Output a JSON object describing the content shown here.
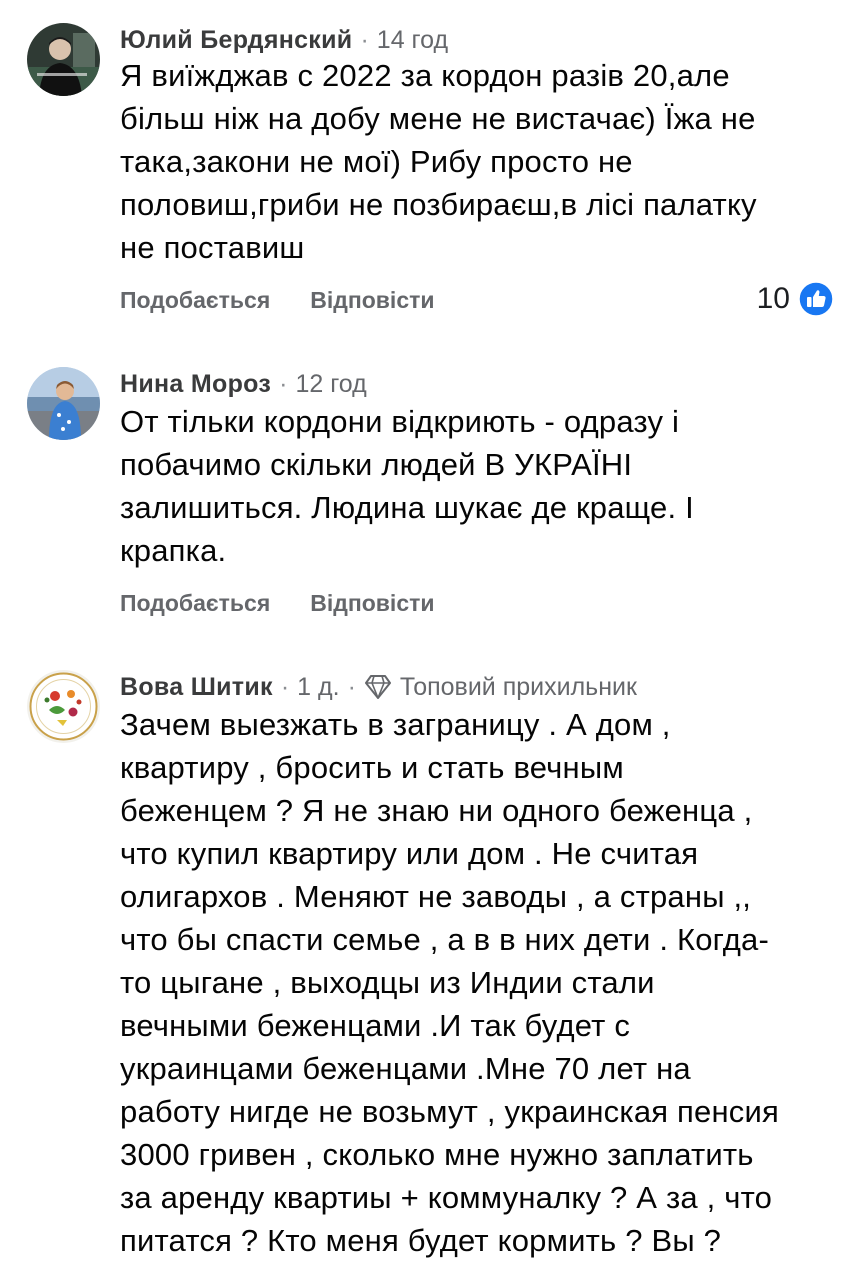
{
  "comments": [
    {
      "author": "Юлий Бердянский",
      "separator": "·",
      "time": "14 год",
      "text": "Я виїжджав с 2022 за кордон разів 20,але\nбільш ніж на добу мене не вистачає) Їжа не\nтака,закони не мої) Рибу просто не\nполовиш,гриби не позбираєш,в лісі палатку\nне поставиш",
      "like_label": "Подобається",
      "reply_label": "Відповісти",
      "reaction_count": "10",
      "reaction_icon": "like-thumb-icon"
    },
    {
      "author": "Нина Мороз",
      "separator": "·",
      "time": "12 год",
      "text": "От тільки кордони відкриють - одразу і\nпобачимо скільки людей В УКРАЇНІ\nзалишиться.  Людина шукає де краще. І\nкрапка.",
      "like_label": "Подобається",
      "reply_label": "Відповісти"
    },
    {
      "author": "Вова Шитик",
      "separator": "·",
      "time": "1 д.",
      "separator2": "·",
      "badge_icon": "diamond-icon",
      "badge": "Топовий прихильник",
      "text": "Зачем выезжать  в заграницу . А дом ,\nквартиру  , бросить и стать вечным\nбеженцем ? Я не знаю ни одного беженца ,\nчто купил квартиру или дом . Не считая\nолигархов . Меняют  не заводы , а страны ,,\nчто бы спасти семье , а в в них дети . Когда-\nто  цыгане  , выходцы из Индии стали\nвечными беженцами .И так будет с\nукраинцами  беженцами .Мне 70 лет на\nработу нигде не возьмут , украинская пенсия\n3000 гривен , сколько мне нужно заплатить\nза аренду квартиы + коммуналку ? А за , что\nпитатся ? Кто меня будет кормить ? Вы ?"
    }
  ],
  "colors": {
    "text": "#050505",
    "meta": "#65676b",
    "like_blue": "#1877f2"
  }
}
